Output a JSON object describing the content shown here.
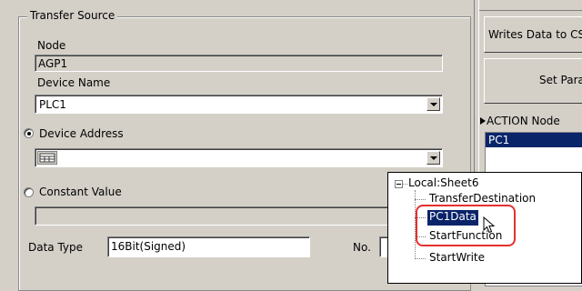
{
  "transfer_source": {
    "group_title": "Transfer Source",
    "node_label": "Node",
    "node_value": "AGP1",
    "device_name_label": "Device Name",
    "device_name_value": "PLC1",
    "device_address_label": "Device Address",
    "device_address_value": "",
    "constant_value_label": "Constant Value",
    "constant_value_value": "",
    "data_type_label": "Data Type",
    "data_type_value": "16Bit(Signed)",
    "no_label": "No."
  },
  "right_panel": {
    "writes_data_button": "Writes Data to CS",
    "set_params_button": "Set Para",
    "action_node_label": "ACTION Node",
    "action_node_items": [
      "PC1"
    ]
  },
  "tree_popup": {
    "root_label": "Local:Sheet6",
    "items": [
      "TransferDestination",
      "PC1Data",
      "StartFunction",
      "StartWrite"
    ],
    "selected_index": 1,
    "highlight_color": "#e53030",
    "selection_color": "#0a246a"
  }
}
